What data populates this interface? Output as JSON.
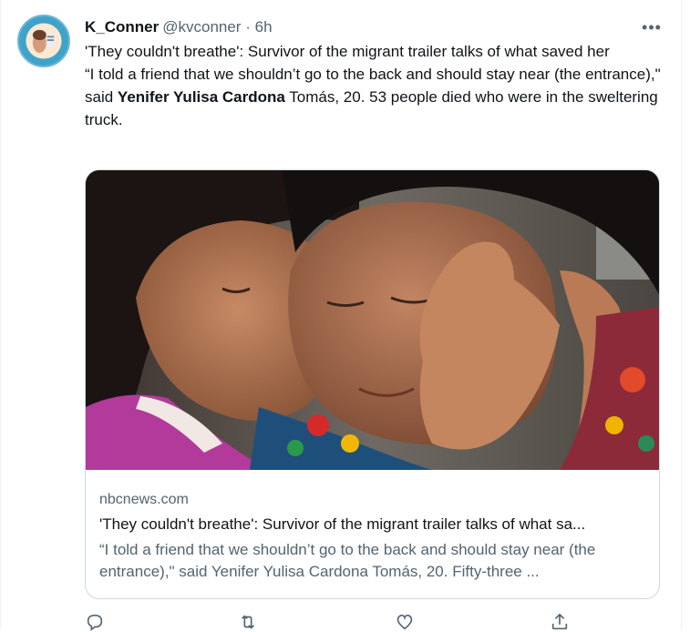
{
  "tweet": {
    "author_name": "K_Conner",
    "author_handle": "@kvconner",
    "separator": "·",
    "time": "6h",
    "menu_label": "•••",
    "line1": "'They couldn't breathe': Survivor of the migrant trailer talks of what saved her",
    "line2_pre": "“I told a friend that we shouldn’t go to the back and should stay near (the entrance),\" said ",
    "line2_bold": "Yenifer Yulisa Cardona",
    "line2_post": " Tomás, 20. 53 people died who were in the sweltering truck."
  },
  "card": {
    "domain": "nbcnews.com",
    "title": "'They couldn't breathe': Survivor of the migrant trailer talks of what sa...",
    "description": "“I told a friend that we shouldn’t go to the back and should stay near (the entrance),\" said Yenifer Yulisa Cardona Tomás, 20. Fifty-three ..."
  },
  "actions": [
    {
      "name": "reply-icon"
    },
    {
      "name": "retweet-icon"
    },
    {
      "name": "like-icon"
    },
    {
      "name": "share-icon"
    }
  ],
  "colors": {
    "text": "#0f1419",
    "secondary": "#536471",
    "border": "#cfd9de",
    "avatar_ring": "#3fa3c9"
  }
}
